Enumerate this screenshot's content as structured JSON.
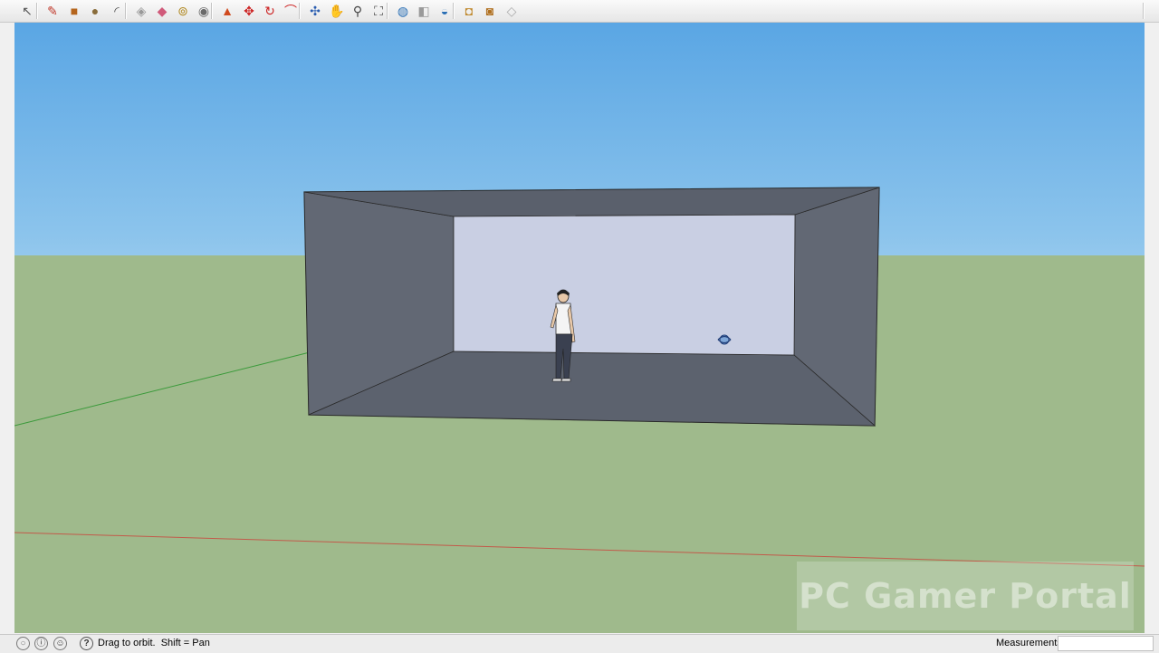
{
  "toolbar": {
    "buttons": [
      {
        "name": "select-tool",
        "glyph": "↖",
        "color": "#555555"
      },
      {
        "name": "line-tool",
        "glyph": "✎",
        "color": "#c0392b"
      },
      {
        "name": "rectangle-tool",
        "glyph": "■",
        "color": "#b5651d"
      },
      {
        "name": "circle-tool",
        "glyph": "●",
        "color": "#8a6d3b"
      },
      {
        "name": "arc-tool",
        "glyph": "◜",
        "color": "#444444"
      },
      {
        "name": "make-component-tool",
        "glyph": "◈",
        "color": "#999999"
      },
      {
        "name": "eraser-tool",
        "glyph": "◆",
        "color": "#d05a7a"
      },
      {
        "name": "tape-measure-tool",
        "glyph": "⊚",
        "color": "#b08820"
      },
      {
        "name": "paint-bucket-tool",
        "glyph": "◉",
        "color": "#6a6a6a"
      },
      {
        "name": "push-pull-tool",
        "glyph": "▲",
        "color": "#d04a1e"
      },
      {
        "name": "move-tool",
        "glyph": "✥",
        "color": "#cc2222"
      },
      {
        "name": "rotate-tool",
        "glyph": "↻",
        "color": "#cc2222"
      },
      {
        "name": "offset-tool",
        "glyph": "⌒",
        "color": "#cc2222"
      },
      {
        "name": "orbit-tool",
        "glyph": "✣",
        "color": "#2a5db0"
      },
      {
        "name": "pan-tool",
        "glyph": "✋",
        "color": "#555555"
      },
      {
        "name": "zoom-tool",
        "glyph": "⚲",
        "color": "#444444"
      },
      {
        "name": "zoom-extents-tool",
        "glyph": "⛶",
        "color": "#444444"
      },
      {
        "name": "get-models-tool",
        "glyph": "◍",
        "color": "#2a6fb5"
      },
      {
        "name": "share-model-tool",
        "glyph": "◧",
        "color": "#9a9a9a"
      },
      {
        "name": "google-earth-tool",
        "glyph": "◒",
        "color": "#2a6fb5"
      },
      {
        "name": "get-photo-texture-tool",
        "glyph": "◘",
        "color": "#c08a30"
      },
      {
        "name": "extension-warehouse-tool",
        "glyph": "◙",
        "color": "#b07020"
      },
      {
        "name": "send-to-layout-tool",
        "glyph": "◇",
        "color": "#aaaaaa"
      }
    ]
  },
  "scene": {
    "sky_color": "#8cc4ec",
    "ground_color": "#9fba8c",
    "box_face_color": "#5e6470",
    "box_back_wall_color": "#c9cfe3",
    "green_axis_color": "#3a9a3a",
    "red_axis_color": "#c25a4a"
  },
  "watermark": {
    "text": "PC Gamer Portal"
  },
  "statusbar": {
    "icons": [
      "geo-location-icon",
      "credits-icon",
      "user-icon",
      "help-icon"
    ],
    "text": "Drag to orbit.  Shift = Pan",
    "measurements_label": "Measurements",
    "measurements_value": ""
  }
}
